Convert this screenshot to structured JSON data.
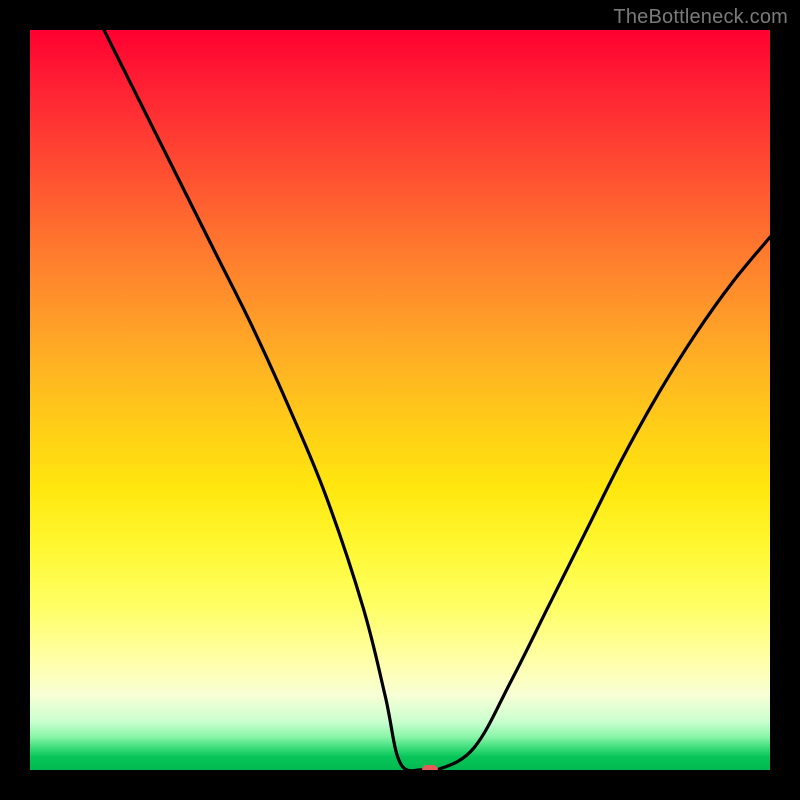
{
  "watermark": "TheBottleneck.com",
  "chart_data": {
    "type": "line",
    "title": "",
    "xlabel": "",
    "ylabel": "",
    "xlim": [
      0,
      100
    ],
    "ylim": [
      0,
      100
    ],
    "grid": false,
    "legend": false,
    "series": [
      {
        "name": "bottleneck-curve",
        "color": "#000000",
        "x": [
          10,
          15,
          20,
          25,
          30,
          35,
          40,
          45,
          48,
          50,
          53,
          55,
          60,
          65,
          70,
          75,
          80,
          85,
          90,
          95,
          100
        ],
        "y": [
          100,
          90,
          80,
          70,
          60,
          49,
          37,
          22,
          10,
          1,
          0,
          0,
          3,
          12,
          22,
          32,
          42,
          51,
          59,
          66,
          72
        ]
      }
    ],
    "marker": {
      "name": "optimal-point",
      "x": 54,
      "y": 0,
      "color": "#e85a5a"
    },
    "background_gradient": {
      "top": "#ff0030",
      "mid": "#ffe70e",
      "bottom": "#00b84f"
    }
  }
}
